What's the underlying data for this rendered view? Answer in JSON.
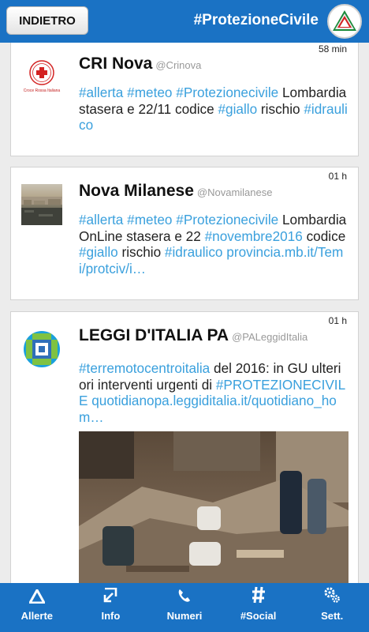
{
  "header": {
    "back_label": "INDIETRO",
    "title": "#ProtezioneCivile"
  },
  "posts": [
    {
      "name": "CRI Nova",
      "handle": "@Crinova",
      "time": "58 min",
      "avatar_text": "Croce Rossa Italiana",
      "body": [
        {
          "t": "#allerta",
          "type": "tag"
        },
        {
          "t": " ",
          "type": "text"
        },
        {
          "t": "#meteo",
          "type": "tag"
        },
        {
          "t": " ",
          "type": "text"
        },
        {
          "t": "#Protezionecivile",
          "type": "tag"
        },
        {
          "t": " Lombardia stasera e 22/11 codice ",
          "type": "text"
        },
        {
          "t": "#giallo",
          "type": "tag"
        },
        {
          "t": " rischio ",
          "type": "text"
        },
        {
          "t": "#idraulico",
          "type": "tag"
        }
      ]
    },
    {
      "name": "Nova Milanese",
      "handle": "@Novamilanese",
      "time": "01 h",
      "body": [
        {
          "t": "#allerta",
          "type": "tag"
        },
        {
          "t": " ",
          "type": "text"
        },
        {
          "t": "#meteo",
          "type": "tag"
        },
        {
          "t": " ",
          "type": "text"
        },
        {
          "t": "#Protezionecivile",
          "type": "tag"
        },
        {
          "t": " LombardiaOnLine stasera e 22 ",
          "type": "text"
        },
        {
          "t": "#novembre2016",
          "type": "tag"
        },
        {
          "t": " codice ",
          "type": "text"
        },
        {
          "t": "#giallo",
          "type": "tag"
        },
        {
          "t": " rischio ",
          "type": "text"
        },
        {
          "t": "#idraulico",
          "type": "tag"
        },
        {
          "t": " ",
          "type": "text"
        },
        {
          "t": "provincia.mb.it/Temi/protciv/i…",
          "type": "link"
        }
      ]
    },
    {
      "name": "LEGGI D'ITALIA PA",
      "handle": "@PALeggidItalia",
      "time": "01 h",
      "body": [
        {
          "t": "#terremotocentroitalia",
          "type": "tag"
        },
        {
          "t": " del 2016: in GU ulteriori interventi urgenti di ",
          "type": "text"
        },
        {
          "t": "#PROTEZIONECIVILE",
          "type": "tag"
        },
        {
          "t": " ",
          "type": "text"
        },
        {
          "t": "quotidianopa.leggiditalia.it/quotidiano_hom…",
          "type": "link"
        }
      ]
    }
  ],
  "tabs": [
    {
      "label": "Allerte",
      "icon": "warning-triangle-icon"
    },
    {
      "label": "Info",
      "icon": "download-arrow-icon"
    },
    {
      "label": "Numeri",
      "icon": "phone-icon"
    },
    {
      "label": "#Social",
      "icon": "hashtag-icon"
    },
    {
      "label": "Sett.",
      "icon": "gears-icon"
    }
  ],
  "colors": {
    "bar": "#1a72c4",
    "tag": "#3aa0dd",
    "background": "#ececec"
  }
}
